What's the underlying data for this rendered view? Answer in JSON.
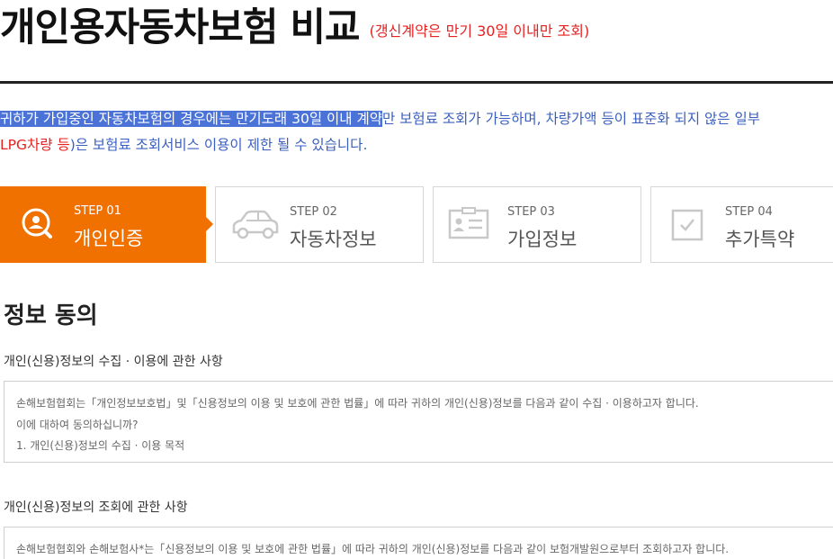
{
  "header": {
    "title": "개인용자동차보험 비교",
    "note": "(갱신계약은 만기 30일 이내만 조회)"
  },
  "notice": {
    "highlight": "귀하가 가입중인 자동차보험의 경우에는 만기도래 30일 이내 계약",
    "rest": "만 보험료 조회가 가능하며, 차량가액 등이 표준화 되지 않은 일부",
    "line2_red": "LPG차량 등",
    "line2_rest": ")은 보험료 조회서비스 이용이 제한 될 수 있습니다."
  },
  "steps": [
    {
      "num": "STEP 01",
      "label": "개인인증",
      "icon": "search-person-icon",
      "active": true
    },
    {
      "num": "STEP 02",
      "label": "자동차정보",
      "icon": "car-icon",
      "active": false
    },
    {
      "num": "STEP 03",
      "label": "가입정보",
      "icon": "id-card-icon",
      "active": false
    },
    {
      "num": "STEP 04",
      "label": "추가특약",
      "icon": "checkbox-icon",
      "active": false
    }
  ],
  "consent": {
    "title": "정보 동의",
    "section1": {
      "heading": "개인(신용)정보의 수집 · 이용에 관한 사항",
      "lines": [
        "손해보험협회는「개인정보보호법」및「신용정보의 이용 및 보호에 관한 법률」에 따라 귀하의 개인(신용)정보를 다음과 같이 수집 · 이용하고자 합니다.",
        "이에 대하여 동의하십니까?",
        "1. 개인(신용)정보의 수집 · 이용 목적"
      ]
    },
    "section2": {
      "heading": "개인(신용)정보의 조회에 관한 사항",
      "lines": [
        "손해보험협회와 손해보험사*는「신용정보의 이용 및 보호에 관한 법률」에 따라 귀하의 개인(신용)정보를 다음과 같이 보험개발원으로부터 조회하고자 합니다."
      ]
    }
  },
  "colors": {
    "accent": "#f07000",
    "notice_blue": "#3a5fbf",
    "highlight_bg": "#4b72d6",
    "red": "#e52222"
  }
}
